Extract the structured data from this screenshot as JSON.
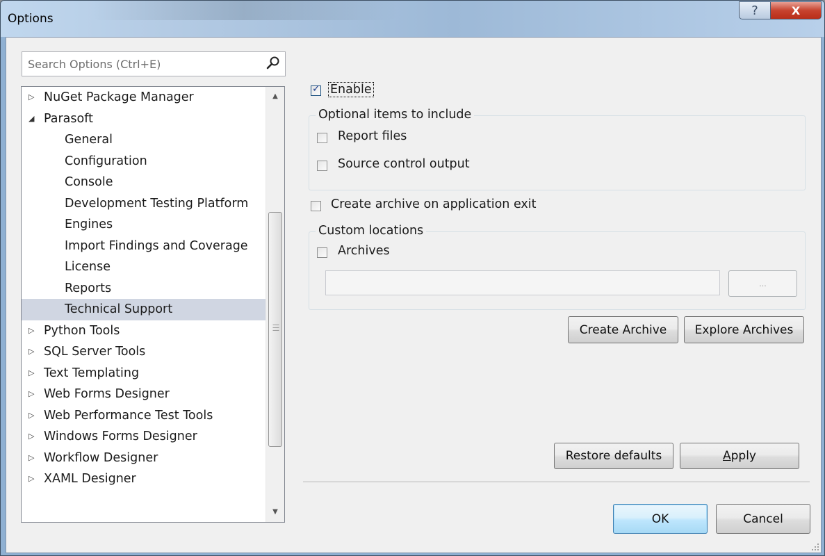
{
  "window": {
    "title": "Options",
    "help_glyph": "?",
    "close_glyph": "X"
  },
  "search": {
    "placeholder": "Search Options (Ctrl+E)",
    "icon": "search-icon"
  },
  "tree": {
    "items": [
      {
        "label": "NuGet Package Manager",
        "level": 0,
        "expanded": false
      },
      {
        "label": "Parasoft",
        "level": 0,
        "expanded": true
      },
      {
        "label": "General",
        "level": 1
      },
      {
        "label": "Configuration",
        "level": 1
      },
      {
        "label": "Console",
        "level": 1
      },
      {
        "label": "Development Testing Platform",
        "level": 1
      },
      {
        "label": "Engines",
        "level": 1
      },
      {
        "label": "Import Findings and Coverage",
        "level": 1
      },
      {
        "label": "License",
        "level": 1
      },
      {
        "label": "Reports",
        "level": 1
      },
      {
        "label": "Technical Support",
        "level": 1,
        "selected": true
      },
      {
        "label": "Python Tools",
        "level": 0,
        "expanded": false
      },
      {
        "label": "SQL Server Tools",
        "level": 0,
        "expanded": false
      },
      {
        "label": "Text Templating",
        "level": 0,
        "expanded": false
      },
      {
        "label": "Web Forms Designer",
        "level": 0,
        "expanded": false
      },
      {
        "label": "Web Performance Test Tools",
        "level": 0,
        "expanded": false
      },
      {
        "label": "Windows Forms Designer",
        "level": 0,
        "expanded": false
      },
      {
        "label": "Workflow Designer",
        "level": 0,
        "expanded": false
      },
      {
        "label": "XAML Designer",
        "level": 0,
        "expanded": false
      }
    ]
  },
  "settings": {
    "enable": {
      "label": "Enable",
      "checked": true
    },
    "optional_group": {
      "title": "Optional items to include",
      "report_files": {
        "label": "Report files",
        "checked": false
      },
      "source_control": {
        "label": "Source control output",
        "checked": false
      }
    },
    "archive_on_exit": {
      "label": "Create archive on application exit",
      "checked": false
    },
    "custom_group": {
      "title": "Custom locations",
      "archives": {
        "label": "Archives",
        "checked": false
      },
      "path_value": "",
      "browse_label": "..."
    },
    "create_archive_label": "Create Archive",
    "explore_archives_label": "Explore Archives",
    "restore_defaults_label": "Restore defaults",
    "apply_label": "Apply"
  },
  "footer": {
    "ok_label": "OK",
    "cancel_label": "Cancel"
  },
  "colors": {
    "selection": "#d0d6e2",
    "close_button": "#c7432f",
    "default_button_border": "#3c7fb1"
  }
}
